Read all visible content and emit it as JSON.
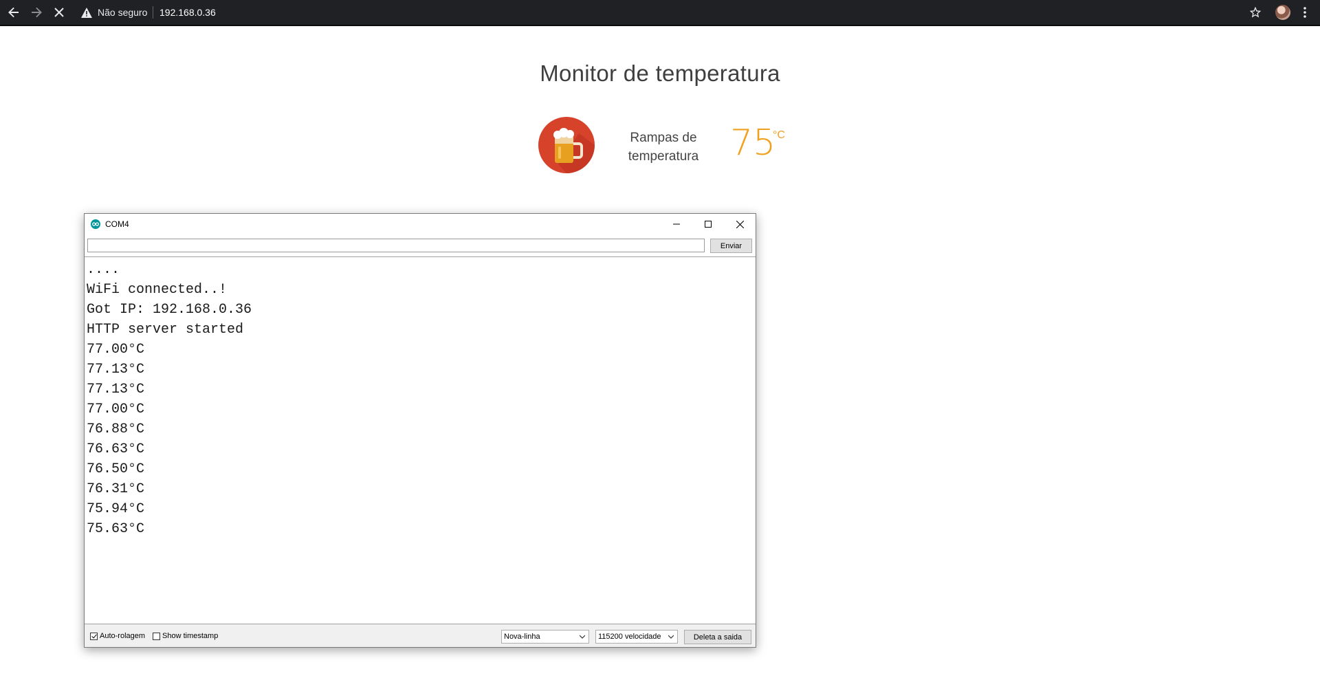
{
  "browser": {
    "security_text": "Não seguro",
    "url": "192.168.0.36"
  },
  "page": {
    "title": "Monitor de temperatura",
    "card_label_line1": "Rampas de",
    "card_label_line2": "temperatura",
    "temperature": "75",
    "unit": "°C",
    "accent_color": "#f0a020",
    "icon_color": "#d7422b"
  },
  "serial_monitor": {
    "title": "COM4",
    "input_value": "",
    "send_label": "Enviar",
    "output": [
      "....",
      "WiFi connected..!",
      "Got IP: 192.168.0.36",
      "HTTP server started",
      "77.00°C",
      "77.13°C",
      "77.13°C",
      "77.00°C",
      "76.88°C",
      "76.63°C",
      "76.50°C",
      "76.31°C",
      "75.94°C",
      "75.63°C"
    ],
    "autoscroll_label": "Auto-rolagem",
    "autoscroll_checked": true,
    "timestamp_label": "Show timestamp",
    "timestamp_checked": false,
    "line_ending": "Nova-linha",
    "baud_rate": "115200 velocidade",
    "clear_label": "Deleta a saida"
  }
}
